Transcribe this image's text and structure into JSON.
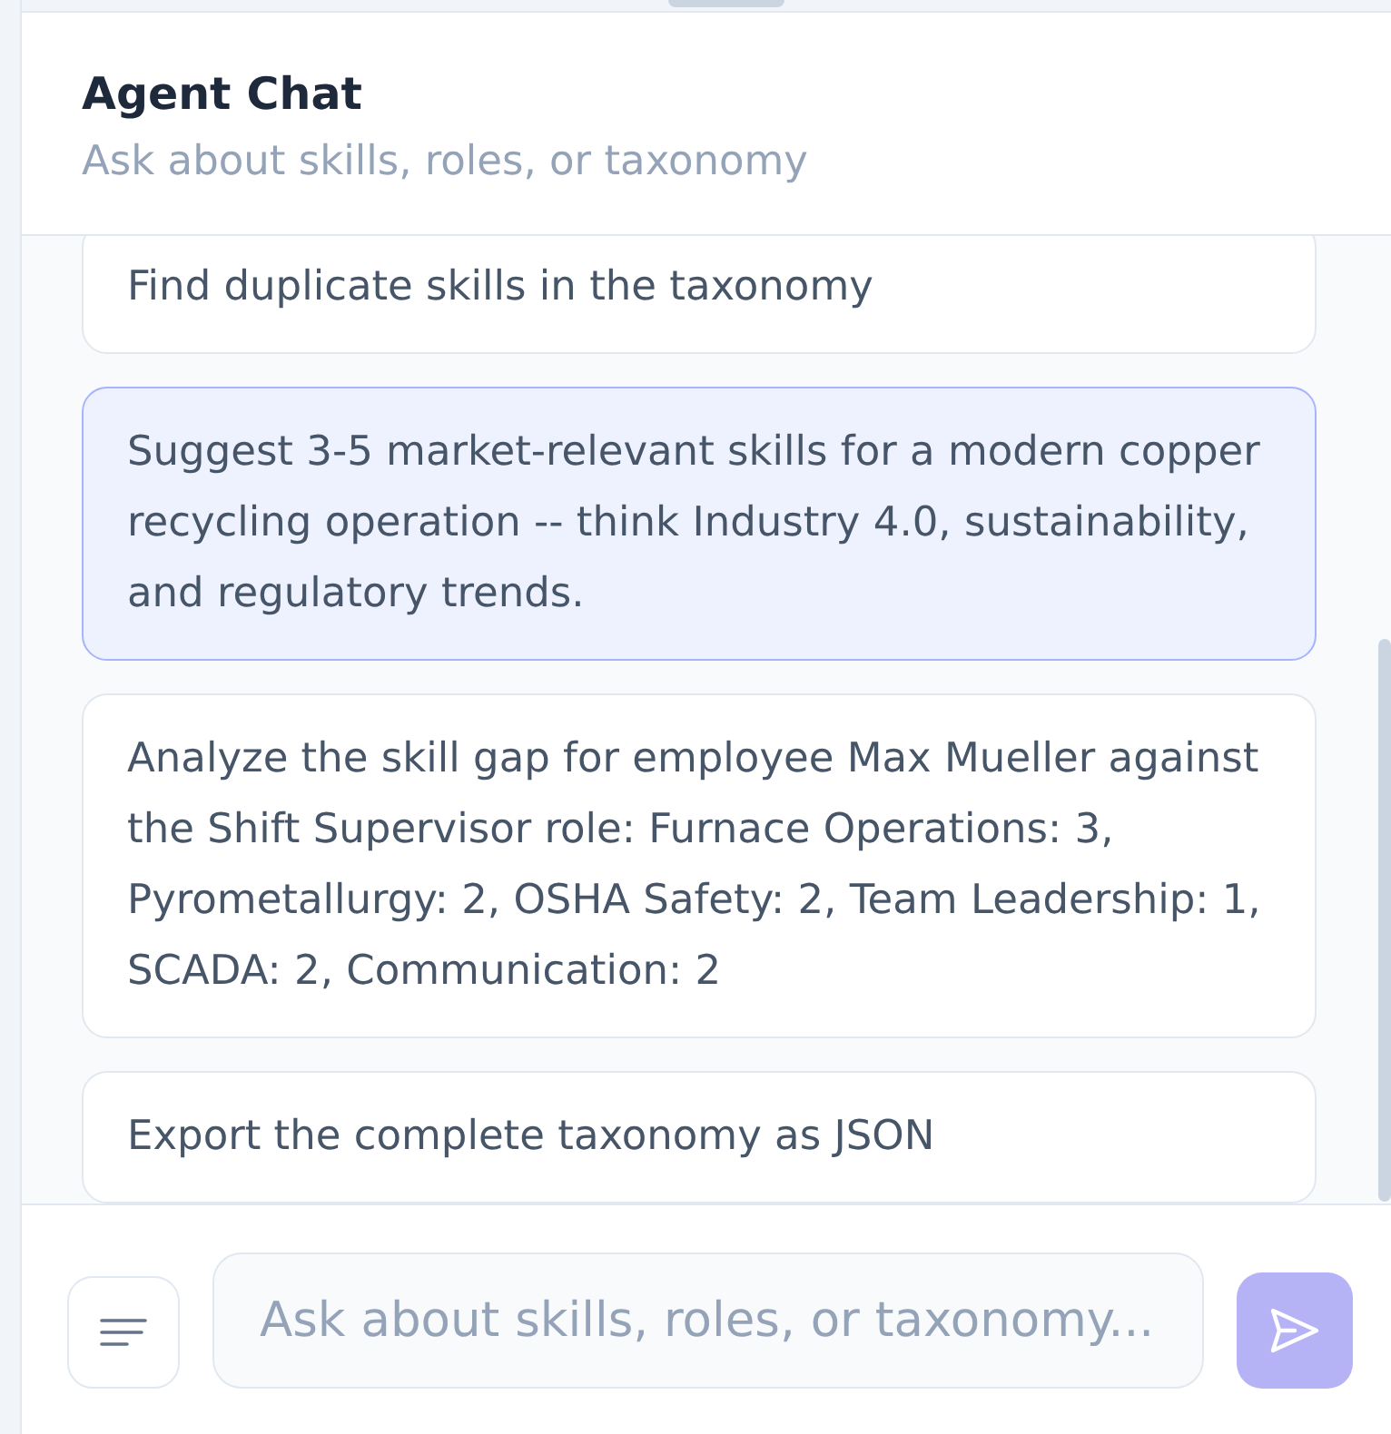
{
  "header": {
    "title": "Agent Chat",
    "subtitle": "Ask about skills, roles, or taxonomy"
  },
  "suggestions": [
    {
      "text": "Find duplicate skills in the taxonomy",
      "selected": false
    },
    {
      "text": "Suggest 3-5 market-relevant skills for a modern copper recycling operation -- think Industry 4.0, sustainability, and regulatory trends.",
      "selected": true
    },
    {
      "text": "Analyze the skill gap for employee Max Mueller against the Shift Supervisor role: Furnace Operations: 3, Pyrometallurgy: 2, OSHA Safety: 2, Team Leadership: 1, SCADA: 2, Communication: 2",
      "selected": false
    },
    {
      "text": "Export the complete taxonomy as JSON",
      "selected": false
    }
  ],
  "composer": {
    "placeholder": "Ask about skills, roles, or taxonomy...",
    "send_button": {
      "disabled": true
    }
  }
}
